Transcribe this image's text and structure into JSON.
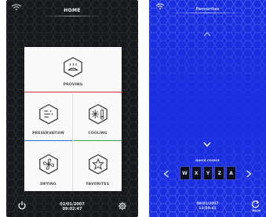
{
  "left_screen": {
    "title": "HOME",
    "tiles": {
      "proving": "PROVING",
      "preservation": "PRESERVATION",
      "cooling": "COOLING",
      "drying": "DRYING",
      "favorites": "FAVORITES"
    },
    "date": "02/01/2007",
    "time": "09:02:47",
    "icons": [
      "wifi-icon",
      "proving-icon",
      "preservation-icon",
      "cooling-icon",
      "drying-icon",
      "favorites-icon",
      "power-icon",
      "settings-icon"
    ]
  },
  "right_screen": {
    "title": "Favourites",
    "quick_choice_label": "QUICK CHOICE",
    "quick_choices": [
      "W",
      "X",
      "Y",
      "Z",
      "A"
    ],
    "date": "09/01/2007",
    "time": "13:59:41",
    "back_label": "BACK",
    "icons": [
      "wifi-icon",
      "chevron-up-icon",
      "chevron-down-icon",
      "arrow-left-icon",
      "arrow-right-icon",
      "back-icon"
    ]
  },
  "colors": {
    "left_bg": "#17191c",
    "right_bg": "#1b2ee0",
    "proving_accent": "#d0303a",
    "preservation_accent": "#2a6fd6",
    "cooling_accent": "#38a84a"
  }
}
